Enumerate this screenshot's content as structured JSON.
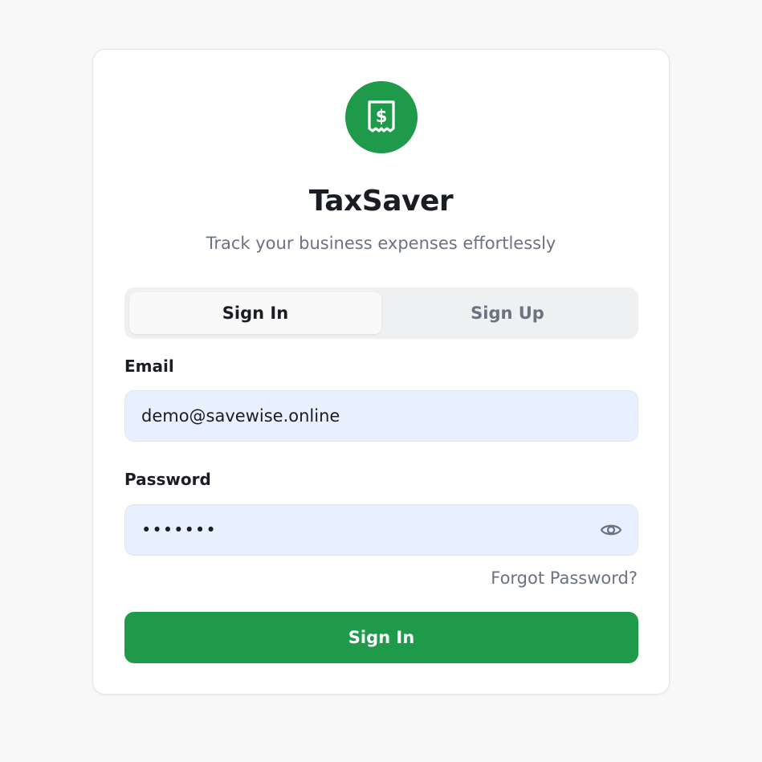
{
  "brand": {
    "title": "TaxSaver",
    "subtitle": "Track your business expenses effortlessly",
    "logo_icon": "receipt-dollar-icon",
    "accent_color": "#1f9a4a"
  },
  "tabs": [
    {
      "label": "Sign In",
      "active": true
    },
    {
      "label": "Sign Up",
      "active": false
    }
  ],
  "form": {
    "email": {
      "label": "Email",
      "value": "demo@savewise.online"
    },
    "password": {
      "label": "Password",
      "value": "•••••••",
      "toggle_icon": "eye-icon"
    },
    "forgot_label": "Forgot Password?",
    "submit_label": "Sign In"
  }
}
